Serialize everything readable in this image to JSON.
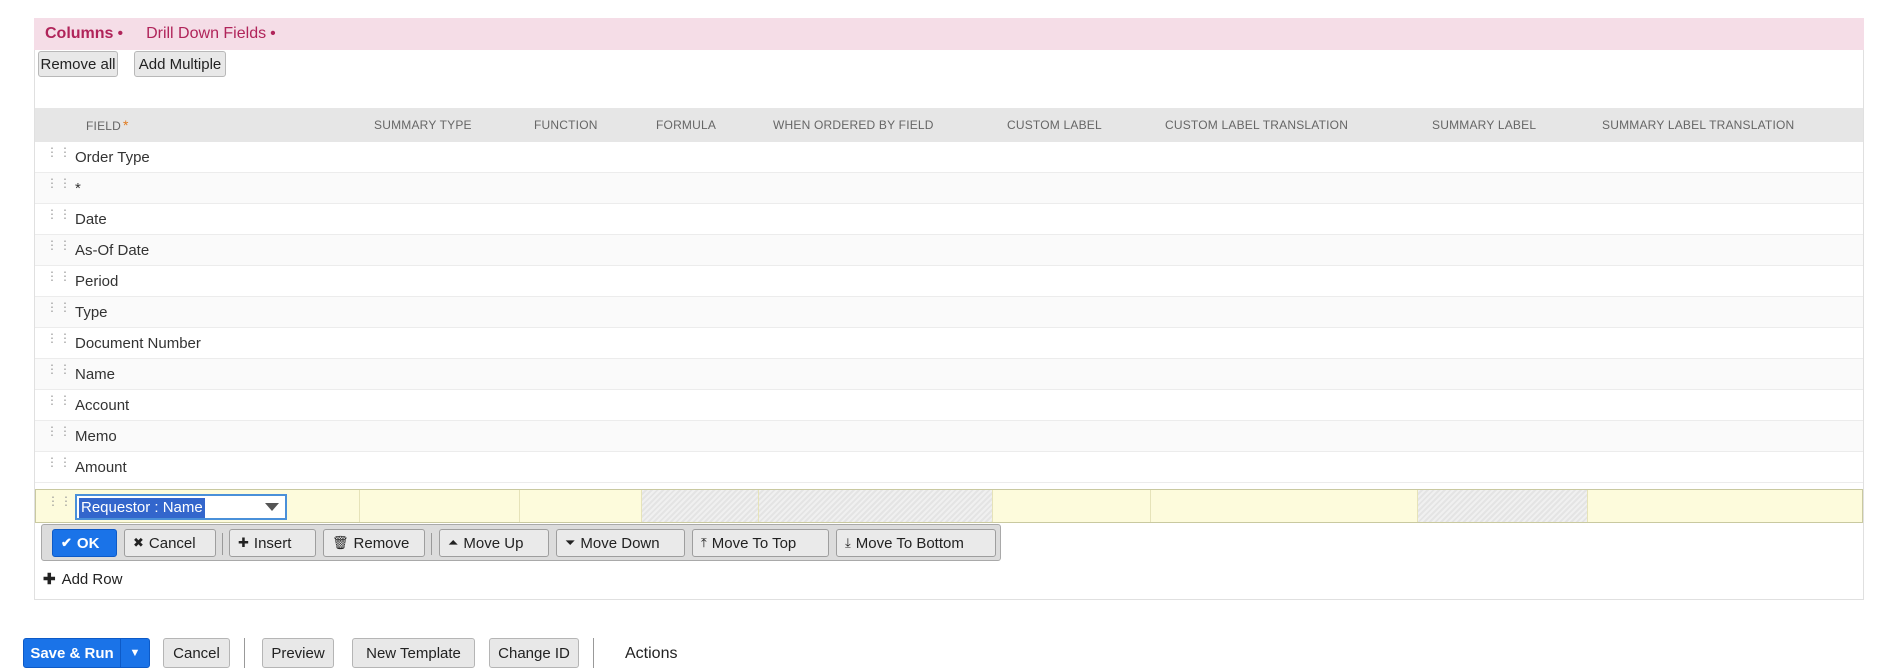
{
  "tabs": [
    {
      "label": "Columns",
      "dot": "•"
    },
    {
      "label": "Drill Down Fields",
      "dot": "•"
    }
  ],
  "toolbar": {
    "remove_all": "Remove all",
    "add_multiple": "Add Multiple"
  },
  "columns": {
    "field": "FIELD",
    "field_required": "*",
    "summary_type": "SUMMARY TYPE",
    "function": "FUNCTION",
    "formula": "FORMULA",
    "when_ordered_by_field": "WHEN ORDERED BY FIELD",
    "custom_label": "CUSTOM LABEL",
    "custom_label_translation": "CUSTOM LABEL TRANSLATION",
    "summary_label": "SUMMARY LABEL",
    "summary_label_translation": "SUMMARY LABEL TRANSLATION"
  },
  "rows": [
    "Order Type",
    "*",
    "Date",
    "As-Of Date",
    "Period",
    "Type",
    "Document Number",
    "Name",
    "Account",
    "Memo",
    "Amount"
  ],
  "edit_row": {
    "field_value": "Requestor : Name"
  },
  "row_actions": {
    "ok": "OK",
    "cancel": "Cancel",
    "insert": "Insert",
    "remove": "Remove",
    "move_up": "Move Up",
    "move_down": "Move Down",
    "move_to_top": "Move To Top",
    "move_to_bottom": "Move To Bottom"
  },
  "add_row": "Add Row",
  "footer": {
    "save_run": "Save & Run",
    "cancel": "Cancel",
    "preview": "Preview",
    "new_template": "New Template",
    "change_id": "Change ID",
    "actions": "Actions"
  },
  "colors": {
    "accent": "#1a73e8",
    "tab_bg": "#f5dde7",
    "tab_text": "#b0245a",
    "edit_row_bg": "#fdfbdc"
  }
}
